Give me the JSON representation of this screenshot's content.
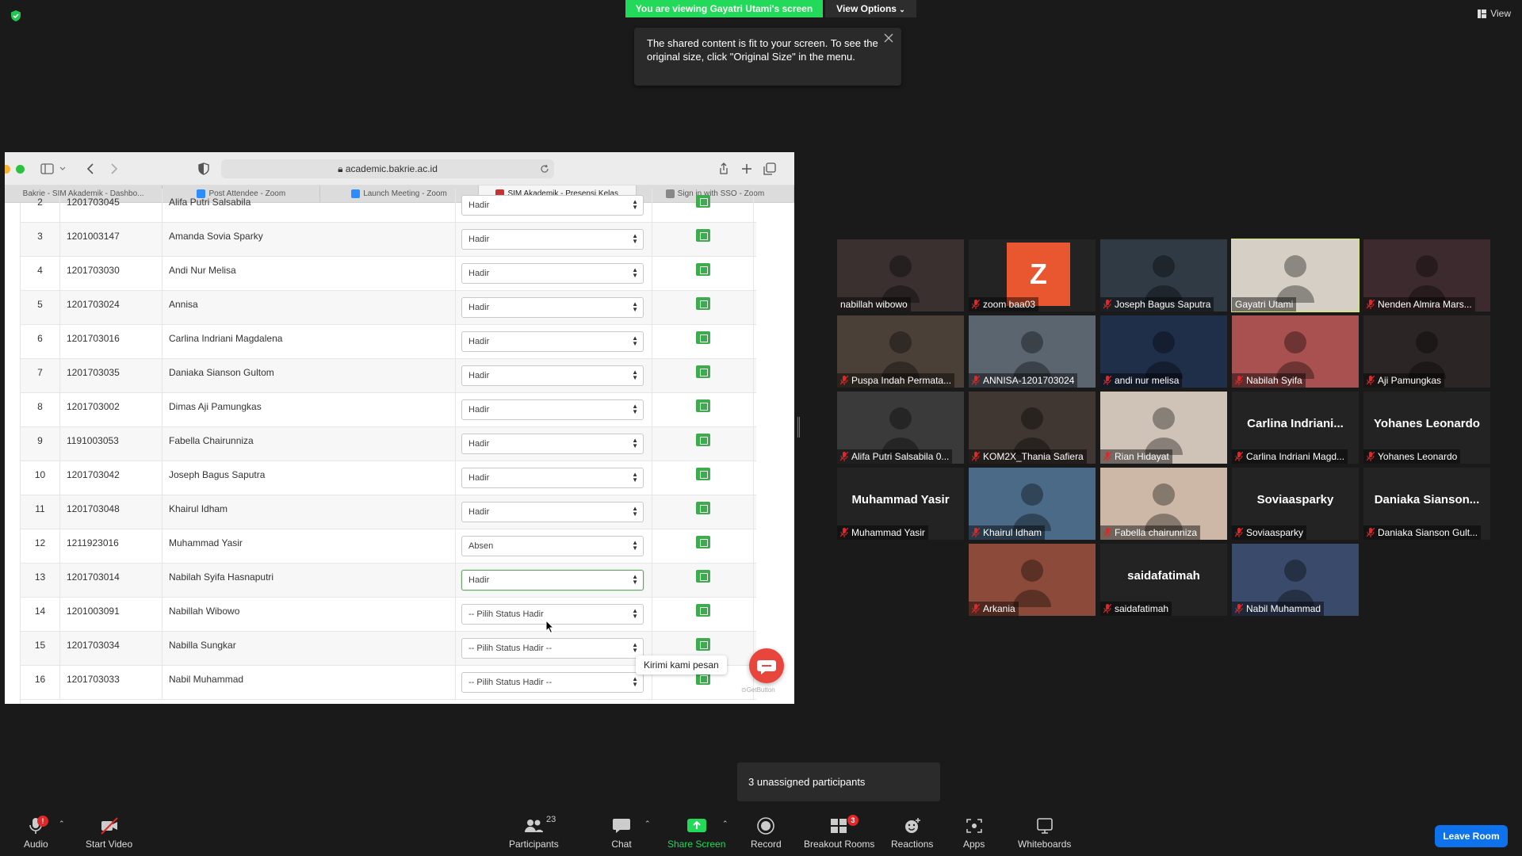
{
  "top": {
    "viewing_banner": "You are viewing Gayatri Utami's screen",
    "view_options": "View Options",
    "view_button": "View",
    "tooltip": "The shared content is fit to your screen. To see the original size, click \"Original Size\" in the menu."
  },
  "browser": {
    "url": "academic.bakrie.ac.id",
    "tabs": [
      {
        "label": "Bakrie - SIM Akademik - Dashbo...",
        "active": false
      },
      {
        "label": "Post Attendee - Zoom",
        "active": false
      },
      {
        "label": "Launch Meeting - Zoom",
        "active": false
      },
      {
        "label": "SIM Akademik - Presensi Kelas",
        "active": true
      },
      {
        "label": "Sign in with SSO - Zoom",
        "active": false
      }
    ]
  },
  "attendance_rows": [
    {
      "no": "2",
      "nim": "1201703045",
      "name": "Alifa Putri Salsabila",
      "status": "Hadir",
      "focused": false
    },
    {
      "no": "3",
      "nim": "1201003147",
      "name": "Amanda Sovia Sparky",
      "status": "Hadir",
      "focused": false
    },
    {
      "no": "4",
      "nim": "1201703030",
      "name": "Andi Nur Melisa",
      "status": "Hadir",
      "focused": false
    },
    {
      "no": "5",
      "nim": "1201703024",
      "name": "Annisa",
      "status": "Hadir",
      "focused": false
    },
    {
      "no": "6",
      "nim": "1201703016",
      "name": "Carlina Indriani Magdalena",
      "status": "Hadir",
      "focused": false
    },
    {
      "no": "7",
      "nim": "1201703035",
      "name": "Daniaka Sianson Gultom",
      "status": "Hadir",
      "focused": false
    },
    {
      "no": "8",
      "nim": "1201703002",
      "name": "Dimas Aji Pamungkas",
      "status": "Hadir",
      "focused": false
    },
    {
      "no": "9",
      "nim": "1191003053",
      "name": "Fabella Chairunniza",
      "status": "Hadir",
      "focused": false
    },
    {
      "no": "10",
      "nim": "1201703042",
      "name": "Joseph Bagus Saputra",
      "status": "Hadir",
      "focused": false
    },
    {
      "no": "11",
      "nim": "1201703048",
      "name": "Khairul Idham",
      "status": "Hadir",
      "focused": false
    },
    {
      "no": "12",
      "nim": "1211923016",
      "name": "Muhammad Yasir",
      "status": "Absen",
      "focused": false
    },
    {
      "no": "13",
      "nim": "1201703014",
      "name": "Nabilah Syifa Hasnaputri",
      "status": "Hadir",
      "focused": true
    },
    {
      "no": "14",
      "nim": "1201003091",
      "name": "Nabillah Wibowo",
      "status": "-- Pilih Status Hadir",
      "focused": false
    },
    {
      "no": "15",
      "nim": "1201703034",
      "name": "Nabilla Sungkar",
      "status": "-- Pilih Status Hadir --",
      "focused": false
    },
    {
      "no": "16",
      "nim": "1201703033",
      "name": "Nabil Muhammad",
      "status": "-- Pilih Status Hadir --",
      "focused": false
    }
  ],
  "chat_widget": {
    "label": "Kirimi kami pesan",
    "brand": "GetButton"
  },
  "participants_gallery": [
    {
      "name": "nabillah wibowo",
      "muted": false,
      "video": true,
      "big_name": ""
    },
    {
      "name": "zoom baa03",
      "muted": true,
      "video": false,
      "avatar_letter": "Z",
      "big_name": ""
    },
    {
      "name": "Joseph Bagus Saputra",
      "muted": true,
      "video": true,
      "big_name": ""
    },
    {
      "name": "Gayatri Utami",
      "muted": false,
      "video": true,
      "active": true,
      "big_name": ""
    },
    {
      "name": "Nenden Almira Mars...",
      "muted": true,
      "video": true,
      "big_name": ""
    },
    {
      "name": "Puspa Indah Permata...",
      "muted": true,
      "video": true,
      "big_name": ""
    },
    {
      "name": "ANNISA-1201703024",
      "muted": true,
      "video": true,
      "big_name": ""
    },
    {
      "name": "andi nur melisa",
      "muted": true,
      "video": true,
      "big_name": ""
    },
    {
      "name": "Nabilah Syifa",
      "muted": true,
      "video": true,
      "big_name": ""
    },
    {
      "name": "Aji Pamungkas",
      "muted": true,
      "video": true,
      "big_name": ""
    },
    {
      "name": "Alifa Putri Salsabila 0...",
      "muted": true,
      "video": true,
      "big_name": ""
    },
    {
      "name": "KOM2X_Thania Safiera",
      "muted": true,
      "video": true,
      "big_name": ""
    },
    {
      "name": "Rian Hidayat",
      "muted": true,
      "video": true,
      "big_name": ""
    },
    {
      "name": "Carlina Indriani Magd...",
      "muted": true,
      "video": false,
      "big_name": "Carlina  Indriani..."
    },
    {
      "name": "Yohanes Leonardo",
      "muted": true,
      "video": false,
      "big_name": "Yohanes Leonardo"
    },
    {
      "name": "Muhammad Yasir",
      "muted": true,
      "video": false,
      "big_name": "Muhammad Yasir"
    },
    {
      "name": "Khairul Idham",
      "muted": true,
      "video": true,
      "big_name": ""
    },
    {
      "name": "Fabella chairunniza",
      "muted": true,
      "video": true,
      "big_name": ""
    },
    {
      "name": "Soviaasparky",
      "muted": true,
      "video": false,
      "big_name": "Soviaasparky"
    },
    {
      "name": "Daniaka Sianson Gult...",
      "muted": true,
      "video": false,
      "big_name": "Daniaka  Sianson..."
    },
    {
      "name": "Arkania",
      "muted": true,
      "video": true,
      "big_name": ""
    },
    {
      "name": "saidafatimah",
      "muted": true,
      "video": false,
      "big_name": "saidafatimah"
    },
    {
      "name": "Nabil Muhammad",
      "muted": true,
      "video": true,
      "big_name": ""
    }
  ],
  "breakout_popup": "3 unassigned participants",
  "toolbar": {
    "audio": "Audio",
    "start_video": "Start Video",
    "participants": "Participants",
    "participants_count": "23",
    "chat": "Chat",
    "share_screen": "Share Screen",
    "record": "Record",
    "breakout_rooms": "Breakout Rooms",
    "breakout_count": "3",
    "reactions": "Reactions",
    "apps": "Apps",
    "whiteboards": "Whiteboards",
    "leave_room": "Leave Room",
    "audio_alert": "!"
  },
  "colors": {
    "green_banner": "#23d959",
    "leave_blue": "#0e72ed",
    "active_speaker": "#d9ea67",
    "mute_red": "#e02828"
  }
}
